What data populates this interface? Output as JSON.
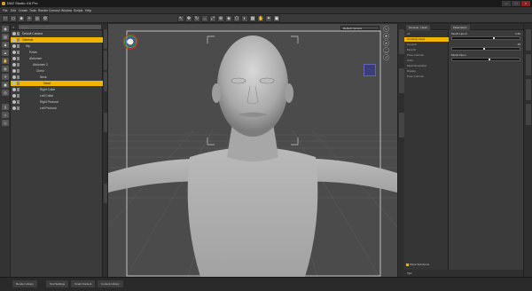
{
  "window": {
    "title": "DAZ Studio 4.6 Pro",
    "minimize": "–",
    "maximize": "□",
    "close": "×"
  },
  "menu": [
    "File",
    "Edit",
    "Create",
    "Tools",
    "Render",
    "Connect",
    "Window",
    "Scripts",
    "Help"
  ],
  "scene": {
    "search_placeholder": "Scene",
    "rows": [
      {
        "label": "Default Camera",
        "indent": 0,
        "selected": false
      },
      {
        "label": "Genesis",
        "indent": 0,
        "selected": true
      },
      {
        "label": "Hip",
        "indent": 1,
        "selected": false
      },
      {
        "label": "Pelvis",
        "indent": 2,
        "selected": false
      },
      {
        "label": "Abdomen",
        "indent": 2,
        "selected": false
      },
      {
        "label": "Abdomen 2",
        "indent": 3,
        "selected": false
      },
      {
        "label": "Chest",
        "indent": 4,
        "selected": false
      },
      {
        "label": "Neck",
        "indent": 5,
        "selected": false
      },
      {
        "label": "Head",
        "indent": 6,
        "selected": true
      },
      {
        "label": "Right Collar",
        "indent": 5,
        "selected": false
      },
      {
        "label": "Left Collar",
        "indent": 5,
        "selected": false
      },
      {
        "label": "Right Pectoral",
        "indent": 5,
        "selected": false
      },
      {
        "label": "Left Pectoral",
        "indent": 5,
        "selected": false
      }
    ]
  },
  "viewport": {
    "camera": "Default Camera",
    "nav_icons": [
      "rotate-icon",
      "pan-icon",
      "zoom-icon",
      "frame-icon",
      "reset-icon"
    ]
  },
  "parameters": {
    "tabs": [
      "Genesis : Head",
      "Parameters"
    ],
    "groups": [
      {
        "label": "All",
        "selected": false
      },
      {
        "label": "Currently Used",
        "selected": true
      },
      {
        "label": "General",
        "selected": false
      },
      {
        "label": "Morphs",
        "selected": false
      },
      {
        "label": "Pose Controls",
        "selected": false
      },
      {
        "label": "Actor",
        "selected": false
      },
      {
        "label": "Mesh Resolution",
        "selected": false
      },
      {
        "label": "Display",
        "selected": false
      },
      {
        "label": "Pose Controls",
        "selected": false
      }
    ],
    "params": [
      {
        "label": "Mouth Lips-S",
        "value": "1.62",
        "fraction": 0.62
      },
      {
        "label": "",
        "value": "35",
        "fraction": 0.48
      },
      {
        "label": "Mouth Open",
        "value": "",
        "fraction": 0.55
      }
    ],
    "show_subitems": "Show Sub-Items",
    "tips": "Tips"
  },
  "bottom_tabs": [
    "Render Library",
    "Tool Settings",
    "Smart Content",
    "Content Library"
  ],
  "colors": {
    "accent": "#f0b400",
    "viewport_bg": "#4b4b4b",
    "grid": "#5e5e5e"
  }
}
